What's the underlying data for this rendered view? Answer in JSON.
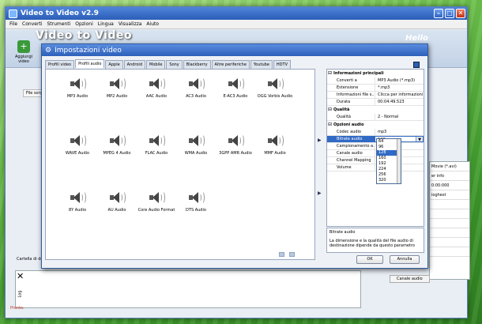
{
  "main_window": {
    "title": "Video to Video v2.9",
    "menu": [
      "File",
      "Converti",
      "Strumenti",
      "Opzioni",
      "Lingua",
      "Visualizza",
      "Aiuto"
    ],
    "big_title": "Video to Video",
    "add_video": "Aggiungi video",
    "file_header": "File sorgente",
    "folder_label": "Cartella di destinaz",
    "log_label": "Log",
    "status": "Pronto.",
    "hello": "Hello",
    "right_items": [
      "Movie (*.avi)",
      "er info",
      "0:00:000",
      "ioghest",
      "",
      "",
      "",
      "",
      "",
      ""
    ],
    "canale": "Canale audio"
  },
  "dialog": {
    "title": "Impostazioni video",
    "tabs": [
      "Profili video",
      "Profili audio",
      "Apple",
      "Android",
      "Mobile",
      "Sony",
      "Blackberry",
      "Altre periferiche",
      "Youtube",
      "HDTV"
    ],
    "formats": [
      "MP3 Audio",
      "MP2 Audio",
      "AAC Audio",
      "AC3 Audio",
      "E-AC3 Audio",
      "OGG Vorbis Audio",
      "WAVE Audio",
      "MPEG 4 Audio",
      "FLAC Audio",
      "WMA Audio",
      "3GPP AMR Audio",
      "MMF Audio",
      " 8Y Audio",
      "AU Audio",
      "Core Audio Format",
      "DTS Audio"
    ],
    "props": {
      "s1": "Informazioni principali",
      "r1": [
        [
          "Converti a",
          "MP3 Audio (*.mp3)"
        ],
        [
          "Estensione",
          "*.mp3"
        ],
        [
          "Informazioni file s...",
          "Clicca per informazioni"
        ],
        [
          "Durata",
          "00:04:49.523"
        ]
      ],
      "s2": "Qualità",
      "r2": [
        [
          "Qualità",
          "2 - Normal"
        ]
      ],
      "s3": "Opzioni audio",
      "r3a": [
        [
          "Codec audio",
          "mp3"
        ]
      ],
      "sel": [
        "Bitrate audio",
        "128"
      ],
      "r3b": [
        [
          "Campionamento a...",
          ""
        ],
        [
          "Canale audio",
          ""
        ],
        [
          "Channel Mapping",
          ""
        ],
        [
          "Volume",
          ""
        ]
      ]
    },
    "bitrate_options": [
      "64",
      "96",
      "128",
      "160",
      "192",
      "224",
      "256",
      "320"
    ],
    "bitrate_selected_index": 2,
    "desc_title": "Bitrate audio",
    "desc_text": "La dimensione e la qualità del file audio di destinazione dipende da questo parametro",
    "ok": "OK",
    "cancel": "Annulla"
  }
}
